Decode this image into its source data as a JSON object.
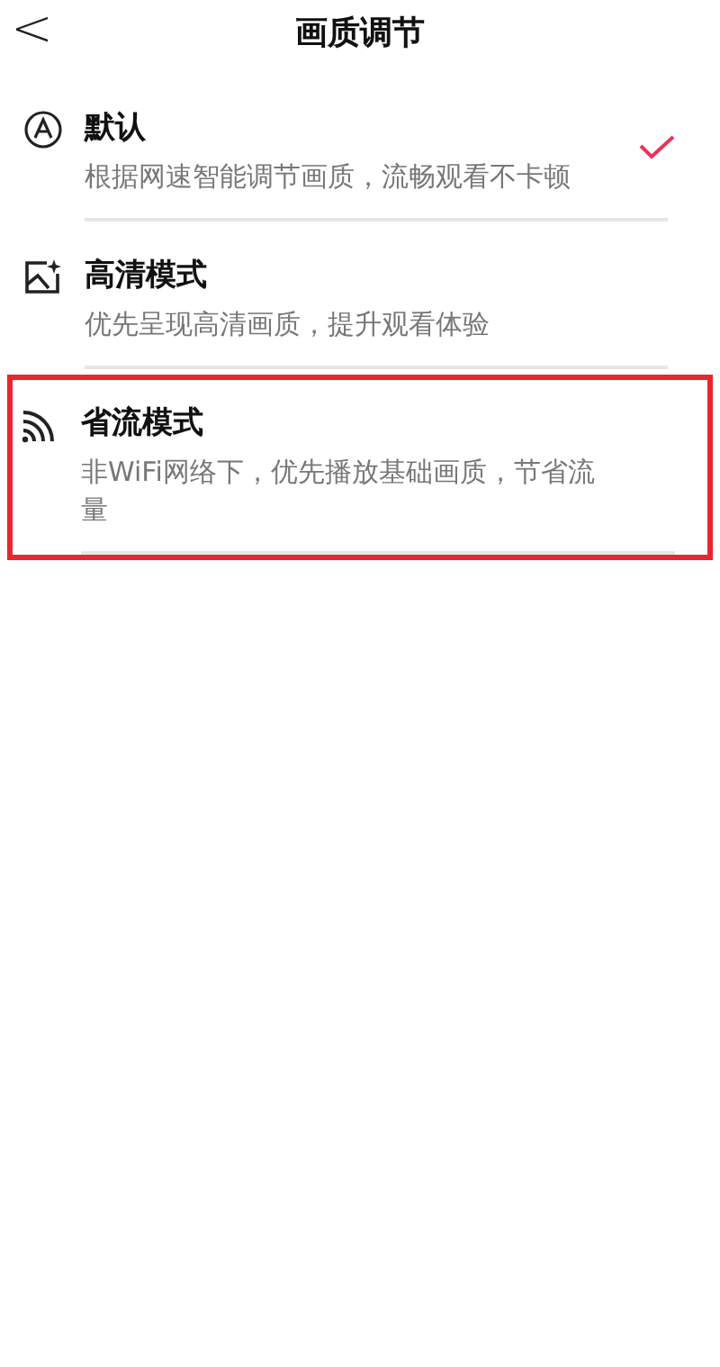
{
  "header": {
    "back": "<",
    "title": "画质调节"
  },
  "options": [
    {
      "kind": "auto",
      "title": "默认",
      "description": "根据网速智能调节画质，流畅观看不卡顿",
      "selected": true,
      "highlighted": false
    },
    {
      "kind": "hd",
      "title": "高清模式",
      "description": "优先呈现高清画质，提升观看体验",
      "selected": false,
      "highlighted": false
    },
    {
      "kind": "saver",
      "title": "省流模式",
      "description": "非WiFi网络下，优先播放基础画质，节省流量",
      "selected": false,
      "highlighted": true
    }
  ]
}
